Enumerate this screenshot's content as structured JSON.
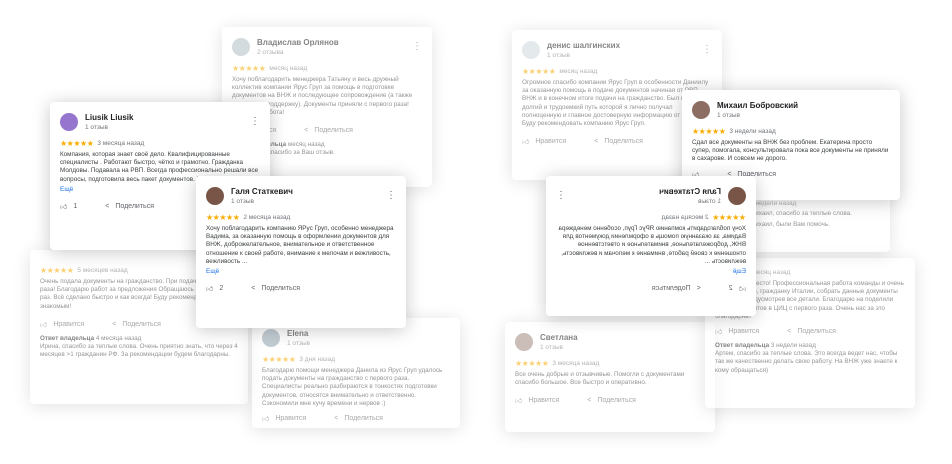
{
  "labels": {
    "more": "Ещё",
    "like": "Нравится",
    "share": "Поделиться",
    "owner": "Ответ владельца"
  },
  "colors": {
    "star": "#f9ab00",
    "link": "#1a73e8",
    "card_shadow": "rgba(0,0,0,.22)"
  },
  "icons": [
    "thumb-up-icon",
    "share-icon",
    "more-vert-icon",
    "star-icon"
  ],
  "cards": {
    "vladislav": {
      "name": "Владислав Орлянов",
      "sub": "2 отзыва",
      "stars": "★★★★★",
      "when": "месяц назад",
      "text": "Хочу поблагодарить менеджера Татьяну и весь дружный коллектив компании Ярус Груп за помощь в подготовке документов на ВНЖ и последующее сопровождение (а также моральную поддержку). Документы приняли с первого раза! Отличная работа!",
      "reply_when": "месяц назад",
      "reply_text": "Владислав, спасибо за Ваш отзыв."
    },
    "liusik": {
      "name": "Liusik Liusik",
      "sub": "1 отзыв",
      "stars": "★★★★★",
      "when": "3 месяца назад",
      "text": "Компания, которая знает своё дело. Квалифицированные специалисты . Работают быстро, чётко и грамотно. Гражданка Молдовы. Подавала на РВП. Всегда профессионально решали все вопросы, подготовила весь пакет документов. Б...",
      "likes": "1"
    },
    "galia": {
      "name": "Галя Статкевич",
      "sub": "1 отзыв",
      "stars": "★★★★★",
      "when": "2 месяца назад",
      "text": "Хочу поблагодарить компанию ЯРус Груп, особенно менеджера Вадима, за оказанную помощь в оформлении документов для ВНЖ, доброжелательное, внимательное и ответственное отношение к своей работе, внимание к мелочам и вежливость, вежливость ...",
      "likes": "2"
    },
    "denis": {
      "name": "денис шалгинских",
      "sub": "1 отзыв",
      "stars": "★★★★★",
      "when": "месяц назад",
      "text": "Огромное спасибо компании Ярус Груп в особенности Даниилу за оказанную помощь в подаче документов начиная от РВП, ВНЖ и в конечном итоге подачи на гражданство. Был проделан долгий и трудоемкий путь которой я лично получал полноценную и главное достоверную информацию от Даниила. Буду рекомендовать компанию Ярус Груп."
    },
    "mikhail": {
      "name": "Михаил Бобровский",
      "sub": "1 отзыв",
      "stars": "★★★★★",
      "when": "3 недели назад",
      "text": "Сдал все документы на ВНЖ без проблем. Екатерина просто супер, помогала, консультировала пока все документы не приняли в сахарове. И совсем не дорого."
    },
    "galia_mirror": {
      "name": "Галя Статкевич",
      "sub": "1 отзыв",
      "stars": "★★★★★",
      "when": "2 месяца назад",
      "text": "Хочу поблагодарить компанию ЯРус Груп, особенно менеджера Вадима, за оказанную помощь в оформлении документов для ВНЖ, доброжелательное, внимательное и ответственное отношение к своей работе, внимание к мелочам и вежливость, вежливость ...",
      "likes": "2"
    },
    "nedeli": {
      "when": "3 недели назад",
      "text1": "Михаил, спасибо за теплые слова.",
      "text2": "Михаил, были Вам помочь."
    },
    "left_bottom": {
      "stars": "★★★★★",
      "when": "5 месяцев назад",
      "text": "Очень подала документы на гражданство. При подаче с первого раза! Благодарю работ за предложения Обращаюсь не в первый раз. Всё сделано быстро и как всегда! Буду рекомендовать своим знакомым!",
      "reply_when": "4 месяца назад",
      "reply_text": "Ирина, спасибо за теплые слова. Очень приятно знать, что через 4 месяцев >1 гражданин РФ. За рекомендации будем благодарны."
    },
    "elena": {
      "name": "Elena",
      "sub": "1 отзыв",
      "stars": "★★★★★",
      "when": "3 дня назад",
      "text": "Благодарю помощи менеджера Данила из Ярус Груп удалось подать документы на гражданство с первого раза. Специалисты реально разбираются в тонкостях подготовки документов, относятся внимательно и ответственно. Сэкономили мне кучу времени и нервов :)"
    },
    "svetlana": {
      "name": "Светлана",
      "sub": "1 отзыв",
      "stars": "★★★★★",
      "when": "3 месяца назад",
      "text": "Все очень добрые и отзывчивые. Помогли с документами спасибо большое. Все быстро и оперативно."
    },
    "right_bottom": {
      "stars": "★★★★★",
      "when": "месяц назад",
      "text": "Прекрасное место! Профессиональная работа команды и очень милую хахкую, гражданку Италии, собрать данные документы для РВП, предусмотрев все детали. Благодарю на поделили пакет документов в ЦИЦ с первого раза. Очень нас за это благодарны!",
      "reply_when": "3 недели назад",
      "reply_text": "Артем, спасибо за теплые слова. Это всегда ведет нас, чтобы так же качественно делать свою работу. На ВНЖ уже знаете к кому обращаться)"
    }
  }
}
